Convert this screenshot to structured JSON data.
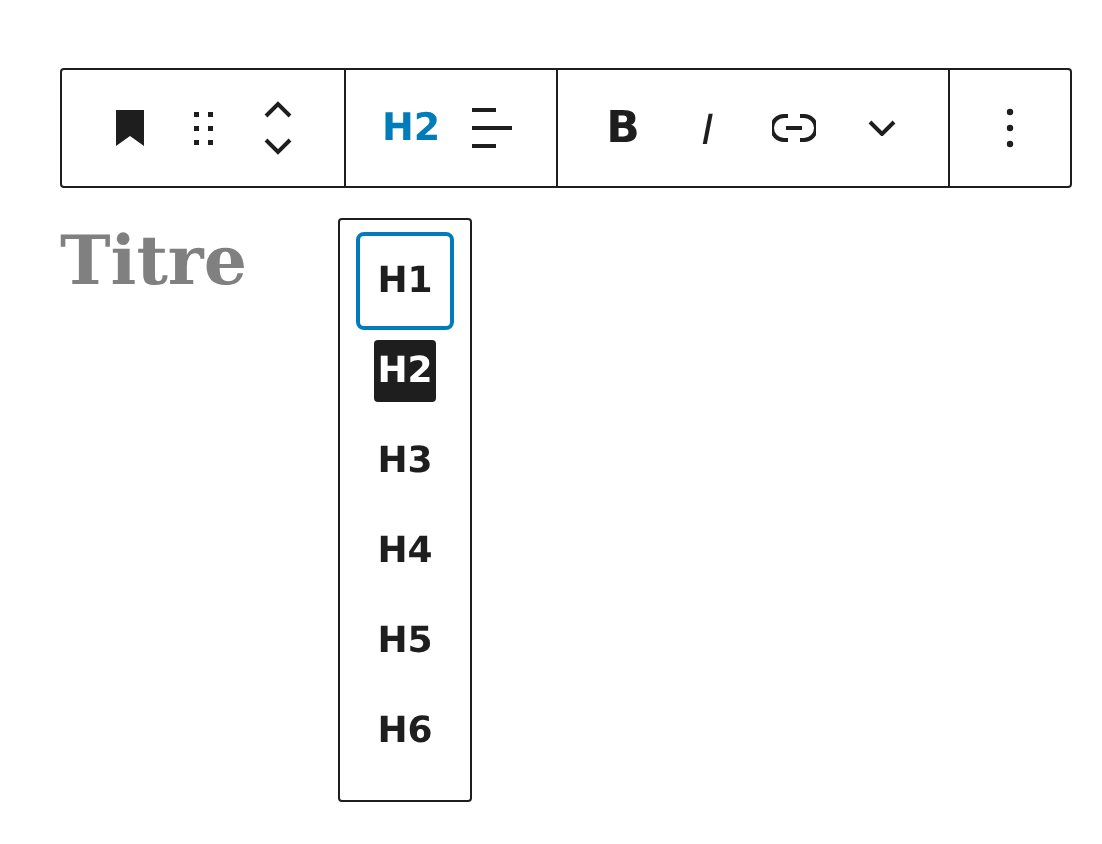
{
  "toolbar": {
    "level_button": "H2",
    "bold_button": "B",
    "italic_button": "I"
  },
  "heading": "Titre",
  "levels": [
    {
      "label": "H1",
      "selected": false,
      "focused": true
    },
    {
      "label": "H2",
      "selected": true,
      "focused": false
    },
    {
      "label": "H3",
      "selected": false,
      "focused": false
    },
    {
      "label": "H4",
      "selected": false,
      "focused": false
    },
    {
      "label": "H5",
      "selected": false,
      "focused": false
    },
    {
      "label": "H6",
      "selected": false,
      "focused": false
    }
  ]
}
